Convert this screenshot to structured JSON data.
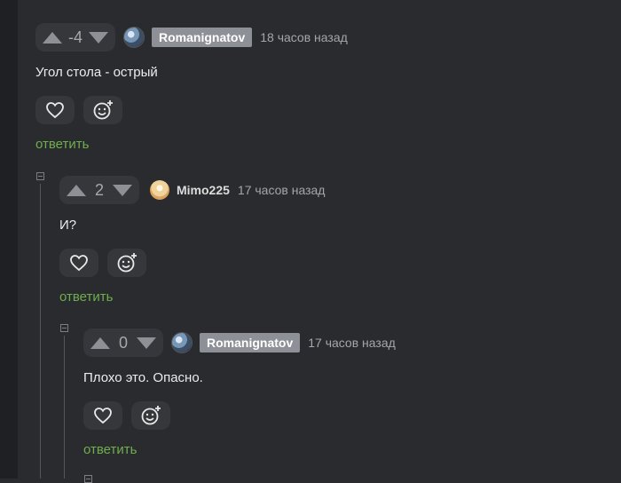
{
  "comments": [
    {
      "score": "-4",
      "author": "Romanignatov",
      "time": "18 часов назад",
      "text": "Угол стола - острый",
      "reply": "ответить"
    },
    {
      "score": "2",
      "author": "Mimo225",
      "time": "17 часов назад",
      "text": "И?",
      "reply": "ответить"
    },
    {
      "score": "0",
      "author": "Romanignatov",
      "time": "17 часов назад",
      "text": "Плохо это. Опасно.",
      "reply": "ответить"
    }
  ],
  "colors": {
    "background": "#2a2b2f",
    "reply_link": "#6fae4c",
    "author_badge": "#8d9096"
  },
  "icons": [
    "upvote-icon",
    "downvote-icon",
    "heart-icon",
    "emoji-add-icon",
    "collapse-icon"
  ]
}
